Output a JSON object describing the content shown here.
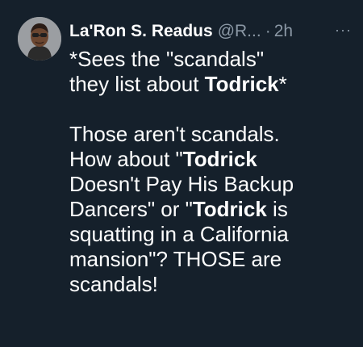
{
  "tweet": {
    "display_name": "La'Ron S. Readus",
    "handle": "@R...",
    "separator": "·",
    "time": "2h",
    "more": "···",
    "lines": [
      {
        "a": "*Sees the \"scandals\"",
        "b": "",
        "c": ""
      },
      {
        "a": "they list about ",
        "b": "Todrick",
        "c": "*"
      },
      {
        "a": "Those aren't scandals.",
        "b": "",
        "c": ""
      },
      {
        "a": "How about \"",
        "b": "Todrick",
        "c": ""
      },
      {
        "a": "Doesn't Pay His Backup",
        "b": "",
        "c": ""
      },
      {
        "a": "Dancers\" or \"",
        "b": "Todrick",
        "c": " is"
      },
      {
        "a": "squatting in a California",
        "b": "",
        "c": ""
      },
      {
        "a": "mansion\"? THOSE are",
        "b": "",
        "c": ""
      },
      {
        "a": "scandals!",
        "b": "",
        "c": ""
      }
    ]
  },
  "icons": {
    "avatar": "profile-photo",
    "more": "more-options-icon"
  },
  "colors": {
    "background": "#15202b",
    "text": "#ffffff",
    "secondary": "#8b98a5"
  }
}
